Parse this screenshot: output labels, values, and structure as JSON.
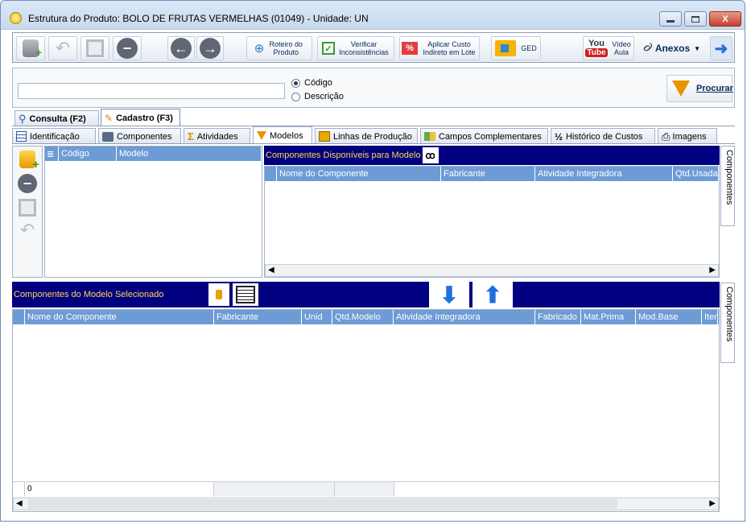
{
  "window": {
    "title": "Estrutura do Produto: BOLO DE FRUTAS VERMELHAS  (01049)   - Unidade: UN",
    "min_label": "▭",
    "max_label": "▭",
    "close_label": "X"
  },
  "toolbar": {
    "roteiro_label": "Roteiro do Produto",
    "verificar_label": "Verificar Inconsistências",
    "aplicar_label": "Aplicar Custo Indireto em Lote",
    "ged_label": "GED",
    "video_label": "Vídeo Aula",
    "youtube_label": "You Tube",
    "anexos_label": "Anexos"
  },
  "search": {
    "value": "",
    "option_codigo": "Código",
    "option_descricao": "Descrição",
    "procurar_label": "Procurar"
  },
  "main_tabs": [
    {
      "label": "Consulta (F2)"
    },
    {
      "label": "Cadastro (F3)"
    }
  ],
  "sub_tabs": [
    {
      "label": "Identificação"
    },
    {
      "label": "Componentes"
    },
    {
      "label": "Atividades"
    },
    {
      "label": "Modelos"
    },
    {
      "label": "Linhas de Produção"
    },
    {
      "label": "Campos Complementares"
    },
    {
      "label": "Histórico de Custos"
    },
    {
      "label": "Imagens"
    }
  ],
  "models_grid": {
    "columns": [
      "Código",
      "Modelo"
    ]
  },
  "available": {
    "title": "Componentes Disponíveis para Modelo",
    "columns": [
      "Nome do Componente",
      "Fabricante",
      "Atividade Integradora",
      "Qtd.Usada"
    ]
  },
  "side_tab_label": "Componentes",
  "selected": {
    "title": "Componentes do Modelo Selecionado",
    "columns": [
      "Nome do Componente",
      "Fabricante",
      "Unid",
      "Qtd.Modelo",
      "Atividade Integradora",
      "Fabricado",
      "Mat.Prima",
      "Mod.Base",
      "Item"
    ],
    "footer_count": "0"
  },
  "colors": {
    "navy": "#000080",
    "header_blue": "#6d9bd5",
    "title_yellow": "#ffd94a"
  }
}
